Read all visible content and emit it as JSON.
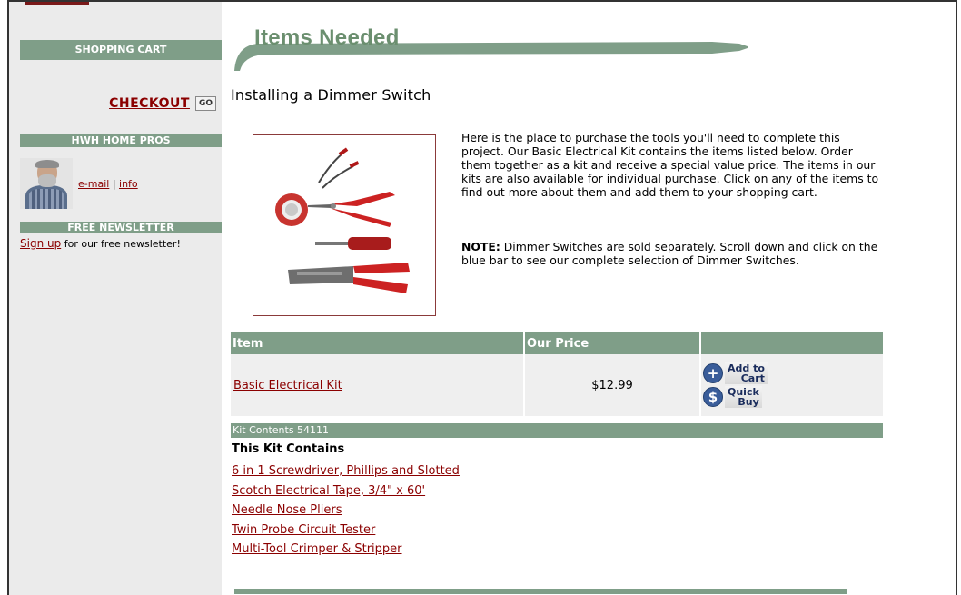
{
  "sidebar": {
    "shopping_cart_heading": "SHOPPING CART",
    "checkout_label": "CHECKOUT",
    "go_label": "GO",
    "home_pros_heading": "HWH HOME PROS",
    "email_label": "e-mail",
    "separator": "|",
    "info_label": "info",
    "newsletter_heading": "FREE NEWSLETTER",
    "signup_label": "Sign up",
    "signup_suffix": " for our free newsletter!"
  },
  "main": {
    "banner_title": "Items Needed",
    "page_title": "Installing a Dimmer Switch",
    "intro_text": "Here is the place to purchase the tools you'll need to complete this project. Our Basic Electrical Kit contains the items listed below. Order them together as a kit and receive a special value price. The items in our kits are also available for individual purchase. Click on any of the items to find out more about them and add them to your shopping cart.",
    "note_label": "NOTE:",
    "note_text": " Dimmer Switches are sold separately. Scroll down and click on the blue bar to see our complete selection of Dimmer Switches."
  },
  "table": {
    "headers": [
      "Item",
      "Our Price",
      ""
    ],
    "row": {
      "item": "Basic Electrical Kit",
      "price": "$12.99",
      "add_to_cart": "Add to Cart",
      "add_line1": "Add to",
      "add_line2": "Cart",
      "quick_line1": "Quick",
      "quick_line2": "Buy"
    }
  },
  "kit": {
    "bar_label": "Kit Contents 54111",
    "heading": "This Kit Contains",
    "items": [
      "6 in 1 Screwdriver, Phillips and Slotted ",
      "Scotch Electrical Tape, 3/4\" x 60'",
      "Needle Nose Pliers",
      "Twin Probe Circuit Tester",
      "Multi-Tool Crimper & Stripper"
    ]
  },
  "colors": {
    "accent_green": "#7f9e88",
    "link_red": "#8b0000",
    "sidebar_gray": "#ebebeb"
  }
}
